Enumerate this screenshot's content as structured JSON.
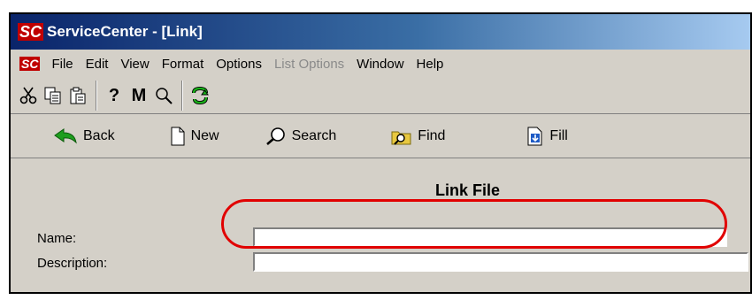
{
  "window": {
    "logo": "SC",
    "title": "ServiceCenter - [Link]"
  },
  "menu": {
    "logo": "SC",
    "items": [
      {
        "label": "File",
        "disabled": false
      },
      {
        "label": "Edit",
        "disabled": false
      },
      {
        "label": "View",
        "disabled": false
      },
      {
        "label": "Format",
        "disabled": false
      },
      {
        "label": "Options",
        "disabled": false
      },
      {
        "label": "List Options",
        "disabled": true
      },
      {
        "label": "Window",
        "disabled": false
      },
      {
        "label": "Help",
        "disabled": false
      }
    ]
  },
  "toolbar": {
    "icons": [
      "cut-icon",
      "copy-icon",
      "paste-icon",
      "help-icon",
      "m-icon",
      "find-icon",
      "refresh-icon"
    ],
    "help_glyph": "?",
    "m_glyph": "M"
  },
  "navbar": {
    "back": "Back",
    "new": "New",
    "search": "Search",
    "find": "Find",
    "fill": "Fill"
  },
  "form": {
    "title": "Link File",
    "name_label": "Name:",
    "name_value": "",
    "description_label": "Description:",
    "description_value": ""
  },
  "colors": {
    "titlebar_start": "#0a246a",
    "titlebar_end": "#a6caf0",
    "highlight": "#e10000",
    "window_bg": "#d4d0c8"
  }
}
